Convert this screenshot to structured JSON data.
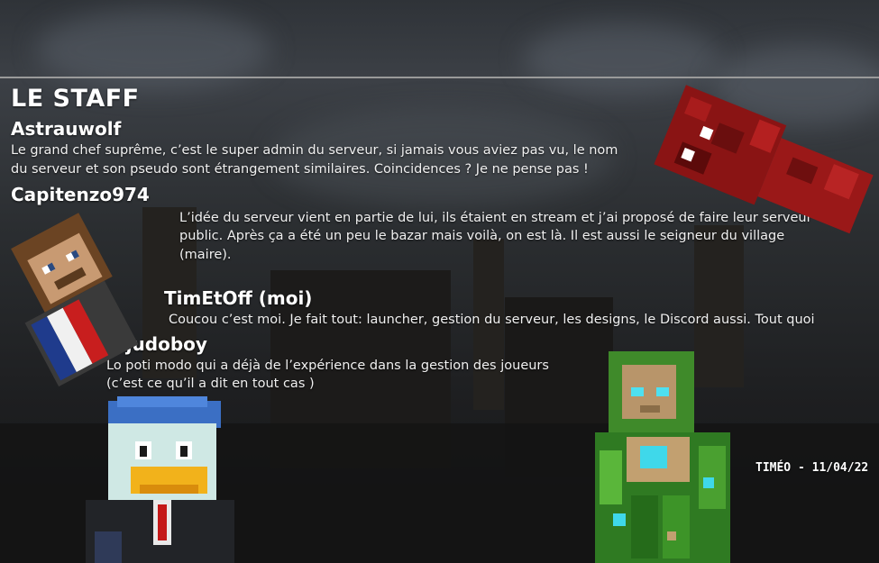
{
  "title": "LE STAFF",
  "staff": [
    {
      "name": "Astrauwolf",
      "lines": [
        "Le grand chef suprême, c’est le super admin du serveur, si jamais vous aviez pas vu, le nom",
        "du serveur et son pseudo sont étrangement similaires. Coincidences ? Je ne pense pas !"
      ]
    },
    {
      "name": "Capitenzo974",
      "lines": [
        "L’idée du serveur vient en partie de lui, ils étaient en stream et j’ai proposé de faire leur serveur",
        "public. Après ça a été un peu le bazar mais voilà, on est là. Il est aussi le seigneur du village",
        "(maire)."
      ]
    },
    {
      "name": "TimEtOff (moi)",
      "lines": [
        "Coucou c’est moi. Je fait tout: launcher, gestion du serveur, les designs, le Discord aussi. Tout quoi"
      ]
    },
    {
      "name": "Jujudoboy",
      "lines": [
        "Lo poti modo qui a déjà de l’expérience dans la gestion des joueurs",
        "(c’est ce qu’il a dit en tout cas )"
      ]
    }
  ],
  "signature": "TIMÉO - 11/04/22"
}
